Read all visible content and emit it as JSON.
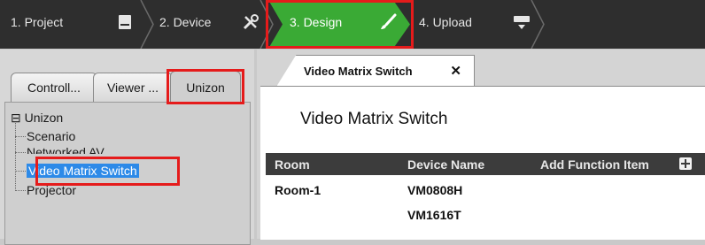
{
  "wizard": {
    "steps": [
      {
        "label": "1. Project",
        "icon": "document-icon",
        "state": "done"
      },
      {
        "label": "2. Device",
        "icon": "tools-icon",
        "state": "done"
      },
      {
        "label": "3. Design",
        "icon": "paintbrush-icon",
        "state": "active"
      },
      {
        "label": "4. Upload",
        "icon": "upload-device-icon",
        "state": "pending"
      }
    ],
    "colors": {
      "bar": "#2e2e2e",
      "active": "#3aaa35",
      "highlight": "#e51b1b"
    }
  },
  "left_panel": {
    "tabs": [
      {
        "label": "Controll..."
      },
      {
        "label": "Viewer ..."
      },
      {
        "label": "Unizon",
        "active": true
      }
    ],
    "tree": {
      "root": {
        "label": "Unizon",
        "expander": "⊟"
      },
      "children": [
        {
          "label": "Scenario"
        },
        {
          "label": "Networked AV"
        },
        {
          "label": "Video Matrix Switch",
          "selected": true
        },
        {
          "label": "Projector"
        }
      ]
    }
  },
  "document": {
    "tab_label": "Video Matrix Switch",
    "close_glyph": "✕",
    "title": "Video Matrix Switch",
    "table": {
      "columns": [
        "Room",
        "Device Name",
        "Add Function Item"
      ],
      "rows": [
        {
          "room": "Room-1",
          "device": "VM0808H"
        },
        {
          "room": "",
          "device": "VM1616T"
        }
      ]
    }
  }
}
